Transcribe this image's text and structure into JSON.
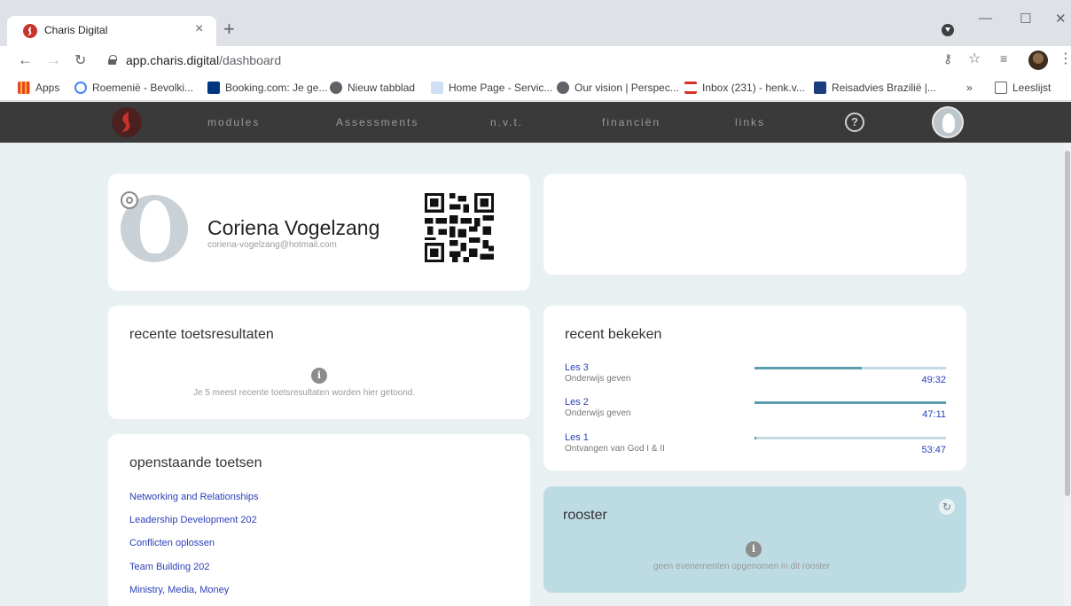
{
  "browser": {
    "tab_title": "Charis Digital",
    "tab_close": "×",
    "new_tab": "+",
    "url_host": "app.charis.digital",
    "url_path": "/dashboard",
    "bookmarks": [
      {
        "label": "Apps",
        "color": "#ea4335"
      },
      {
        "label": "Roemenië - Bevolki...",
        "color": "#4285f4"
      },
      {
        "label": "Booking.com: Je ge...",
        "color": "#003580"
      },
      {
        "label": "Nieuw tabblad",
        "color": "#5f6368"
      },
      {
        "label": "Home Page - Servic...",
        "color": "#7aa7d6"
      },
      {
        "label": "Our vision | Perspec...",
        "color": "#5f6368"
      },
      {
        "label": "Inbox (231) - henk.v...",
        "color": "#d93025"
      },
      {
        "label": "Reisadvies Brazilië |...",
        "color": "#1a3d7c"
      }
    ],
    "bookmarks_more": "»",
    "reading_list": "Leeslijst"
  },
  "nav": {
    "items": [
      "modules",
      "Assessments",
      "n.v.t.",
      "financiën",
      "links"
    ],
    "help": "?"
  },
  "profile": {
    "name": "Coriena Vogelzang",
    "email": "coriena-vogelzang@hotmail.com"
  },
  "recent_results": {
    "title": "recente toetsresultaten",
    "info_icon": "i",
    "empty_message": "Je 5 meest recente toetsresultaten worden hier getoond."
  },
  "open_tests": {
    "title": "openstaande toetsen",
    "items": [
      "Networking and Relationships",
      "Leadership Development 202",
      "Conflicten oplossen",
      "Team Building 202",
      "Ministry, Media, Money"
    ]
  },
  "recently_viewed": {
    "title": "recent bekeken",
    "items": [
      {
        "title": "Les 3",
        "subtitle": "Onderwijs geven",
        "time": "49:32",
        "progress": 0.56
      },
      {
        "title": "Les 2",
        "subtitle": "Onderwijs geven",
        "time": "47:11",
        "progress": 1.0
      },
      {
        "title": "Les 1",
        "subtitle": "Ontvangen van God I & II",
        "time": "53:47",
        "progress": 0.01
      }
    ]
  },
  "schedule": {
    "title": "rooster",
    "info_icon": "i",
    "refresh_icon": "↻",
    "empty_message": "geen evenementen opgenomen in dit rooster"
  },
  "colors": {
    "navbar": "#3a3a3a",
    "link": "#2a3fb8",
    "progress_fill": "#5a9eaf",
    "schedule_bg": "#bcdbe2"
  }
}
